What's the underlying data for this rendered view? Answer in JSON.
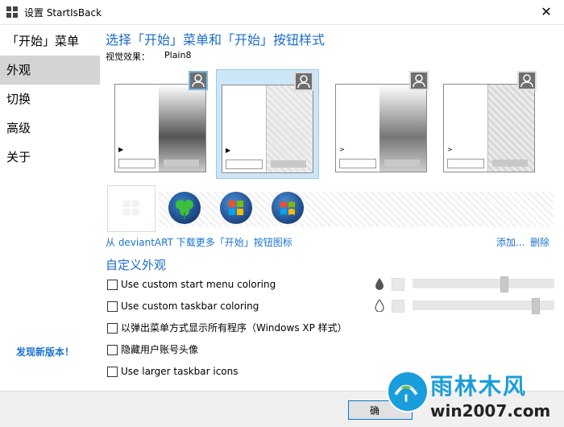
{
  "window": {
    "title": "设置 StartIsBack",
    "close_glyph": "✕"
  },
  "sidebar": {
    "items": [
      {
        "label": "「开始」菜单",
        "selected": false
      },
      {
        "label": "外观",
        "selected": true
      },
      {
        "label": "切换",
        "selected": false
      },
      {
        "label": "高级",
        "selected": false
      },
      {
        "label": "关于",
        "selected": false
      }
    ],
    "update_link": "发现新版本！"
  },
  "main": {
    "title": "选择「开始」菜单和「开始」按钮样式",
    "visual_label": "视觉效果：",
    "visual_value": "Plain8",
    "deviant_link": "从 deviantART 下载更多「开始」按钮图标",
    "add_link": "添加...",
    "delete_link": "删除"
  },
  "custom": {
    "title": "自定义外观",
    "options": [
      {
        "label": "Use custom start menu coloring",
        "checked": false
      },
      {
        "label": "Use custom taskbar coloring",
        "checked": false
      },
      {
        "label": "以弹出菜单方式显示所有程序（Windows XP 样式）",
        "checked": false
      },
      {
        "label": "隐藏用户账号头像",
        "checked": false
      },
      {
        "label": "Use larger taskbar icons",
        "checked": false
      }
    ]
  },
  "footer": {
    "ok_label": "确"
  },
  "watermark": {
    "line1": "雨林木风",
    "line2": "win2007.com"
  },
  "colors": {
    "accent": "#1c6cc8",
    "link": "#1c73cf",
    "selected_bg": "#d4d4d4"
  },
  "sliders": {
    "opacity_level": 0.65,
    "tint_level": 0.88
  }
}
